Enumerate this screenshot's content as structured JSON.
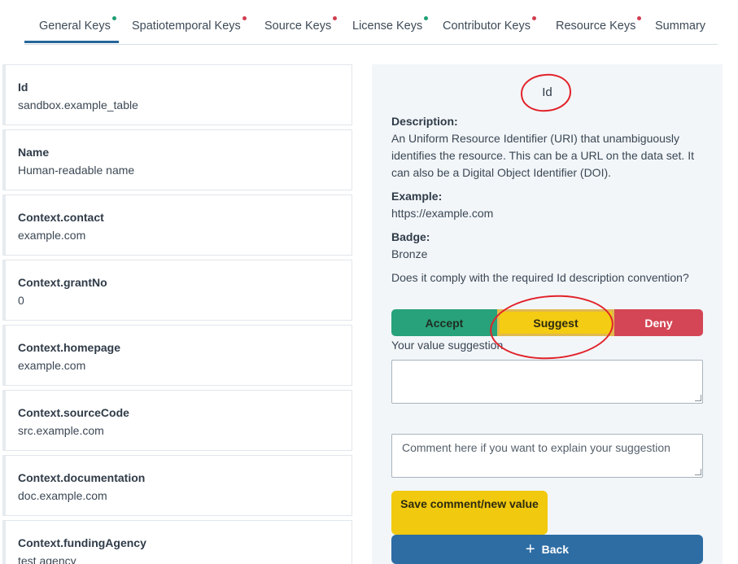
{
  "tabs": [
    {
      "label": "General Keys",
      "status": "green",
      "active": true
    },
    {
      "label": "Spatiotemporal Keys",
      "status": "red"
    },
    {
      "label": "Source Keys",
      "status": "red"
    },
    {
      "label": "License Keys",
      "status": "green"
    },
    {
      "label": "Contributor Keys",
      "status": "red"
    },
    {
      "label": "Resource Keys",
      "status": "red"
    },
    {
      "label": "Summary",
      "status": "none"
    }
  ],
  "keys": [
    {
      "name": "Id",
      "value": "sandbox.example_table"
    },
    {
      "name": "Name",
      "value": "Human-readable name"
    },
    {
      "name": "Context.contact",
      "value": "example.com"
    },
    {
      "name": "Context.grantNo",
      "value": "0"
    },
    {
      "name": "Context.homepage",
      "value": "example.com"
    },
    {
      "name": "Context.sourceCode",
      "value": "src.example.com"
    },
    {
      "name": "Context.documentation",
      "value": "doc.example.com"
    },
    {
      "name": "Context.fundingAgency",
      "value": "test agency"
    }
  ],
  "detail": {
    "title": "Id",
    "description_label": "Description:",
    "description_text": "An Uniform Resource Identifier (URI) that unambiguously identifies the resource. This can be a URL on the data set. It can also be a Digital Object Identifier (DOI).",
    "example_label": "Example:",
    "example_value": "https://example.com",
    "badge_label": "Badge:",
    "badge_value": "Bronze",
    "question": "Does it comply with the required Id description convention?",
    "accept_label": "Accept",
    "suggest_label": "Suggest",
    "deny_label": "Deny",
    "suggestion_label": "Your value suggestion",
    "suggestion_value": "",
    "comment_placeholder": "Comment here if you want to explain your suggestion",
    "save_label": "Save comment/new value",
    "back_label": "Back",
    "back_icon": "plus-icon"
  },
  "colors": {
    "accept": "#28a27a",
    "suggest": "#f3cc13",
    "deny": "#d44655",
    "back": "#2e6da4",
    "annotation": "#e2222a",
    "status_green": "#1e9e74",
    "status_red": "#d03e4f"
  }
}
